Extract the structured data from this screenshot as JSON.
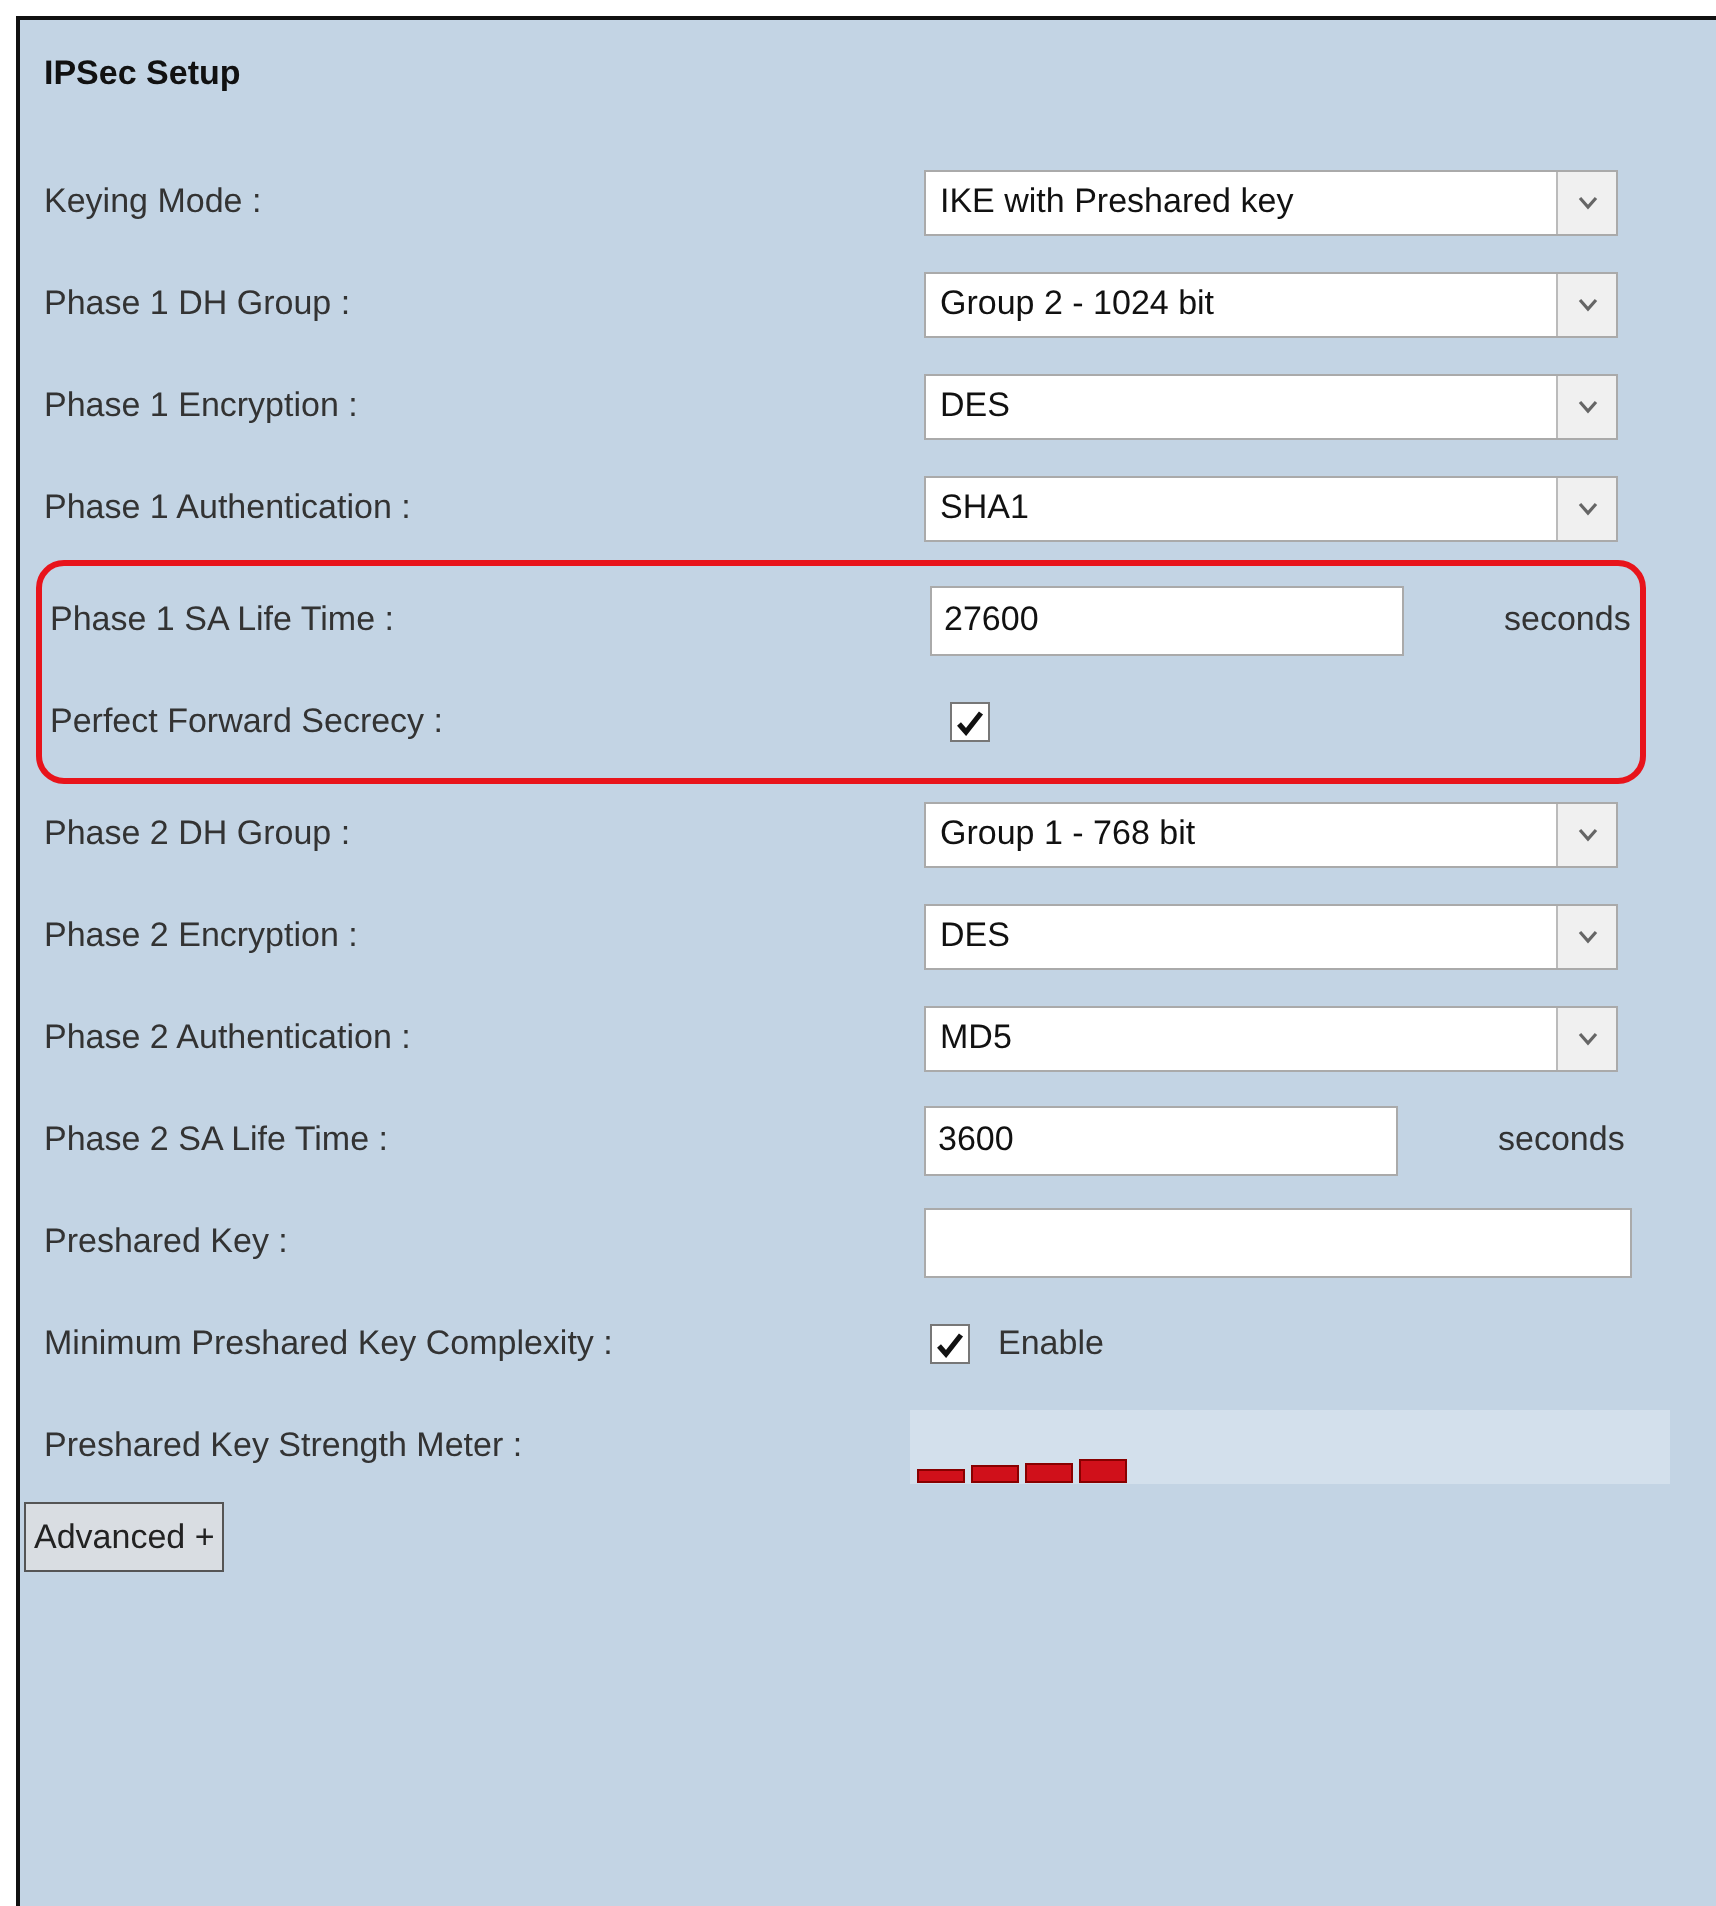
{
  "panel": {
    "title": "IPSec Setup"
  },
  "rows": [
    {
      "kind": "select",
      "label": "Keying Mode :",
      "value": "IKE with Preshared key",
      "highlighted": false
    },
    {
      "kind": "select",
      "label": "Phase 1 DH Group :",
      "value": "Group 2 - 1024 bit",
      "highlighted": false
    },
    {
      "kind": "select",
      "label": "Phase 1 Encryption :",
      "value": "DES",
      "highlighted": false
    },
    {
      "kind": "select",
      "label": "Phase 1 Authentication :",
      "value": "SHA1",
      "highlighted": false
    },
    {
      "kind": "text",
      "label": "Phase 1 SA Life Time :",
      "value": "27600",
      "unit": "seconds",
      "highlighted": true
    },
    {
      "kind": "checkbox",
      "label": "Perfect Forward Secrecy :",
      "checked": true,
      "highlighted": true
    },
    {
      "kind": "select",
      "label": "Phase 2 DH Group :",
      "value": "Group 1 - 768 bit",
      "highlighted": false
    },
    {
      "kind": "select",
      "label": "Phase 2 Encryption :",
      "value": "DES",
      "highlighted": false
    },
    {
      "kind": "select",
      "label": "Phase 2 Authentication :",
      "value": "MD5",
      "highlighted": false
    },
    {
      "kind": "text",
      "label": "Phase 2 SA Life Time :",
      "value": "3600",
      "unit": "seconds",
      "highlighted": false
    },
    {
      "kind": "wide-text",
      "label": "Preshared Key :",
      "highlighted": false
    },
    {
      "kind": "checkbox",
      "label": "Minimum Preshared Key Complexity :",
      "checked": true,
      "option": "Enable",
      "highlighted": false
    },
    {
      "kind": "meter",
      "label": "Preshared Key Strength Meter :",
      "highlighted": false
    }
  ],
  "buttons": [
    {
      "label": "Advanced +"
    }
  ]
}
